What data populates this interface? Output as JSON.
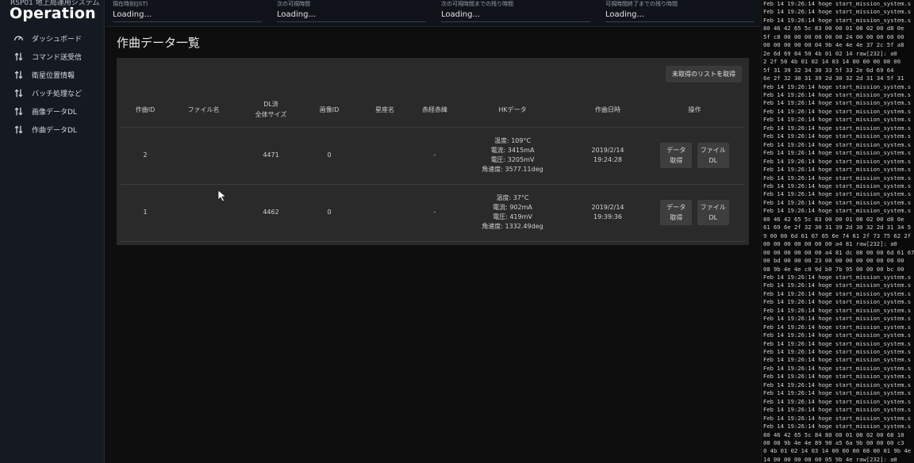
{
  "sidebar": {
    "subtitle": "RSP01 地上局運用システム",
    "title": "Operation",
    "items": [
      {
        "label": "ダッシュボード",
        "icon": "dashboard-icon"
      },
      {
        "label": "コマンド送受信",
        "icon": "transfer-icon"
      },
      {
        "label": "衛星位置情報",
        "icon": "transfer-icon"
      },
      {
        "label": "バッチ処理など",
        "icon": "transfer-icon"
      },
      {
        "label": "画像データDL",
        "icon": "transfer-icon"
      },
      {
        "label": "作曲データDL",
        "icon": "transfer-icon"
      }
    ]
  },
  "status": [
    {
      "label": "現在時刻(JST)",
      "value": "Loading..."
    },
    {
      "label": "次の可視時間",
      "value": "Loading..."
    },
    {
      "label": "次の可視時間までの残り時間",
      "value": "Loading..."
    },
    {
      "label": "可視時間終了までの残り時間",
      "value": "Loading..."
    }
  ],
  "main": {
    "title": "作曲データ一覧",
    "fetch_button": "未取得のリストを取得",
    "columns": [
      "作曲ID",
      "ファイル名",
      "DL済",
      "全体サイズ",
      "画像ID",
      "星座名",
      "赤経赤緯",
      "HKデータ",
      "作曲日時",
      "操作"
    ],
    "rows": [
      {
        "id": "2",
        "file": "",
        "size": "4471",
        "image_id": "0",
        "constellation": "",
        "radec": "-",
        "hk": [
          "温度: 109°C",
          "電流: 3415mA",
          "電圧: 3205mV",
          "角速度: 3577.11deg"
        ],
        "date": "2019/2/14",
        "time": "19:24:28"
      },
      {
        "id": "1",
        "file": "",
        "size": "4462",
        "image_id": "0",
        "constellation": "",
        "radec": "-",
        "hk": [
          "温度: 37°C",
          "電流: 902mA",
          "電圧: 419mV",
          "角速度: 1332.49deg"
        ],
        "date": "2019/2/14",
        "time": "19:39:36"
      }
    ],
    "op_buttons": {
      "data": [
        "データ",
        "取得"
      ],
      "file": [
        "ファイル",
        "DL"
      ]
    }
  },
  "log": [
    "Feb 14 19:26:14 hoge start_mission_system.s",
    "Feb 14 19:26:14 hoge start_mission_system.s",
    "Feb 14 19:26:14 hoge start_mission_system.s",
    " 80 46 42 65 5c 83 00 00 01 08 02 00 d8 0e",
    "5f c8 00 00 00 00 00 00 24 00 00 00 00 00",
    "00 00 00 00 00 04 9b 4e 4e 4e 37 2c 5f a8",
    "2e 6d 69 64 50 4b 01 02 14  raw[232]: a0",
    "2 2f 50 4b 01 02 14 03 14 00 00 00 08 00",
    " 5f 31 39 32 34 30 33 5f 33 2e 6d 69 64",
    "6e 2f 32 30 31 39 2d 30 32 2d 31 34 5f 31",
    "Feb 14 19:26:14 hoge start_mission_system.s",
    "Feb 14 19:26:14 hoge start_mission_system.s",
    "Feb 14 19:26:14 hoge start_mission_system.s",
    "Feb 14 19:26:14 hoge start_mission_system.s",
    "Feb 14 19:26:14 hoge start_mission_system.s",
    "Feb 14 19:26:14 hoge start_mission_system.s",
    "Feb 14 19:26:14 hoge start_mission_system.s",
    "Feb 14 19:26:14 hoge start_mission_system.s",
    "Feb 14 19:26:14 hoge start_mission_system.s",
    "Feb 14 19:26:14 hoge start_mission_system.s",
    "Feb 14 19:26:14 hoge start_mission_system.s",
    "Feb 14 19:26:14 hoge start_mission_system.s",
    "Feb 14 19:26:14 hoge start_mission_system.s",
    "Feb 14 19:26:14 hoge start_mission_system.s",
    "Feb 14 19:26:14 hoge start_mission_system.s",
    "Feb 14 19:26:14 hoge start_mission_system.s",
    " 80 46 42 65 5c 83 00 00 01 08 02 00 d8 0e",
    "61 69 6e 2f 32 30 31 39 2d 30 32 2d 31 34 5",
    "9 00 00 6d 61 67 65 6e 74 61 2f 73 75 62 2f",
    " 00 00 00 00 00 00 00 a4 81  raw[232]: a0",
    "00 00 00 00 00 00 a4 81 dc 08 00 00 6d 61 67",
    "00 bd 00 00 00 23 00 00 00 00 00 00 00 00",
    "08 9b 4e 4e c0 9d b0 7b 95 00 00 00 bc 00",
    "Feb 14 19:26:14 hoge start_mission_system.s",
    "Feb 14 19:26:14 hoge start_mission_system.s",
    "Feb 14 19:26:14 hoge start_mission_system.s",
    "Feb 14 19:26:14 hoge start_mission_system.s",
    "Feb 14 19:26:14 hoge start_mission_system.s",
    "Feb 14 19:26:14 hoge start_mission_system.s",
    "Feb 14 19:26:14 hoge start_mission_system.s",
    "Feb 14 19:26:14 hoge start_mission_system.s",
    "Feb 14 19:26:14 hoge start_mission_system.s",
    "Feb 14 19:26:14 hoge start_mission_system.s",
    "Feb 14 19:26:14 hoge start_mission_system.s",
    "Feb 14 19:26:14 hoge start_mission_system.s",
    "Feb 14 19:26:14 hoge start_mission_system.s",
    "Feb 14 19:26:14 hoge start_mission_system.s",
    "Feb 14 19:26:14 hoge start_mission_system.s",
    "Feb 14 19:26:14 hoge start_mission_system.s",
    "Feb 14 19:26:14 hoge start_mission_system.s",
    "Feb 14 19:26:14 hoge start_mission_system.s",
    "Feb 14 19:26:14 hoge start_mission_system.s",
    " 80 46 42 65 5c 84 80 00 01 08 02 00 68 10",
    "00 08 9b 4e 4e 89 90 a5 6a 9b 00 00 00 c3",
    "0 4b 01 02 14 03 14 00 00 00 08 00 01 9b 4e",
    " 14 00 00 00 08 00 05 9b 4e  raw[232]: a0",
    "2 34 31 30 5f 33 2e 6d 69 64 50 4b 01 02 14",
    "39 2d 30 32 2d 31 34 5f 31 39 32 34 31 30"
  ]
}
